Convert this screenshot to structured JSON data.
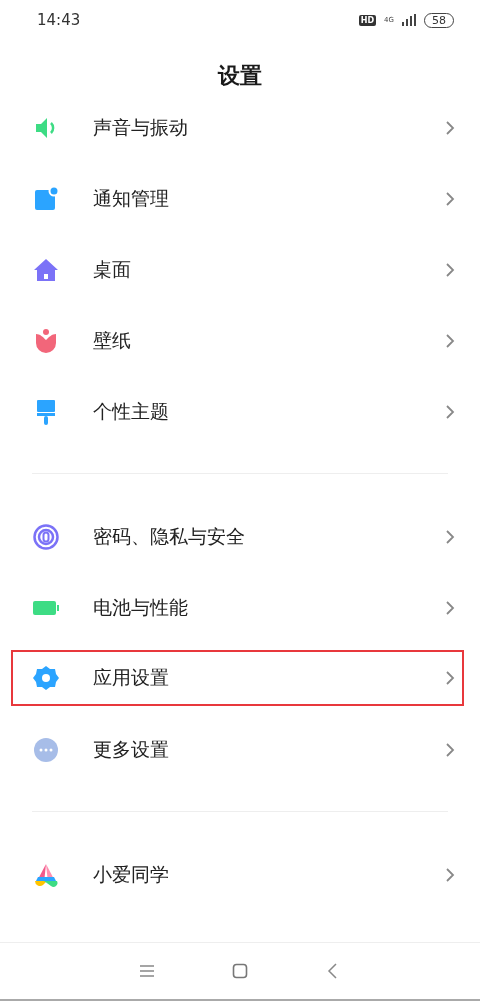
{
  "status_bar": {
    "time": "14:43",
    "hd": "HD",
    "network": "4G",
    "battery": "58"
  },
  "title": "设置",
  "groups": [
    {
      "items": [
        {
          "kind": "sound",
          "label": "声音与振动",
          "highlighted": false
        },
        {
          "kind": "notification",
          "label": "通知管理",
          "highlighted": false
        },
        {
          "kind": "home",
          "label": "桌面",
          "highlighted": false
        },
        {
          "kind": "flower",
          "label": "壁纸",
          "highlighted": false
        },
        {
          "kind": "brush",
          "label": "个性主题",
          "highlighted": false
        }
      ]
    },
    {
      "items": [
        {
          "kind": "fingerprint",
          "label": "密码、隐私与安全",
          "highlighted": false
        },
        {
          "kind": "battery",
          "label": "电池与性能",
          "highlighted": false
        },
        {
          "kind": "gear",
          "label": "应用设置",
          "highlighted": true
        },
        {
          "kind": "more",
          "label": "更多设置",
          "highlighted": false
        }
      ]
    },
    {
      "items": [
        {
          "kind": "assistant",
          "label": "小爱同学",
          "highlighted": false
        }
      ]
    }
  ]
}
